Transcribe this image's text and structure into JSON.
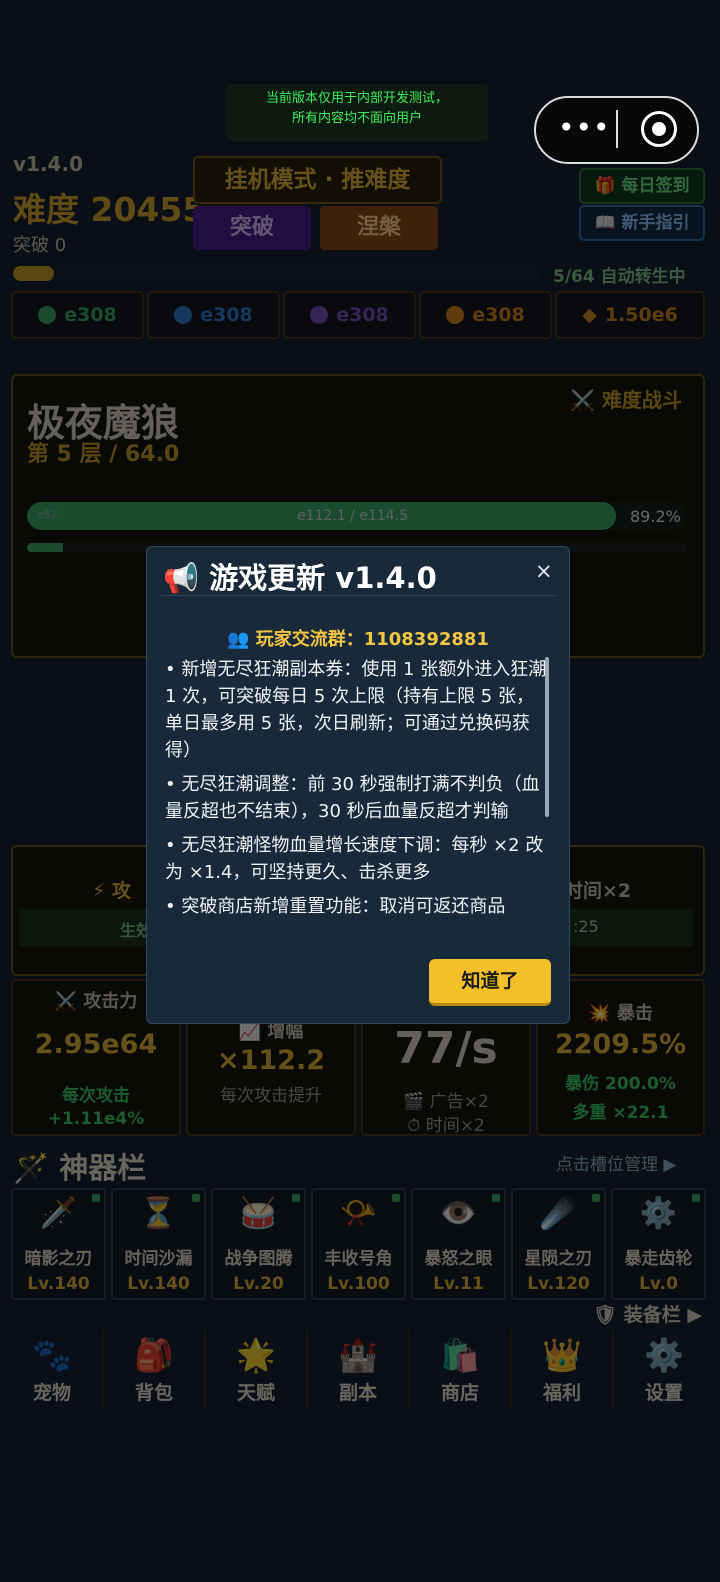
{
  "notice": {
    "line1": "当前版本仅用于内部开发测试，",
    "line2": "所有内容均不面向用户"
  },
  "capsule": {
    "more": "•••"
  },
  "header": {
    "version": "v1.4.0",
    "difficulty": "难度 20455",
    "breakthrough": "突破 0",
    "mode_button": "挂机模式 · 推难度",
    "break_button": "突破",
    "nirvana_button": "涅槃",
    "daily_button": "🎁 每日签到",
    "guide_button": "📖 新手指引",
    "progress_text": "5/64 自动转生中",
    "progress_value": 0.078
  },
  "resources": [
    {
      "value": "e308",
      "color": "#3da866"
    },
    {
      "value": "e308",
      "color": "#2f7fd0"
    },
    {
      "value": "e308",
      "color": "#7a4fc0"
    },
    {
      "value": "e308",
      "color": "#d1861a"
    },
    {
      "value": "1.50e6",
      "color": "#d1861a"
    }
  ],
  "boss": {
    "name": "极夜魔狼",
    "layer": "第 5 层 / 64.0",
    "battle_label": "⚔️ 难度战斗",
    "hp_mini": "e52",
    "hp_text": "e112.1 / e114.5",
    "hp_percent": "89.2%",
    "hp_fill": 0.892,
    "sub_fill": 0.055
  },
  "mid": {
    "left_label": "⚡ 攻",
    "right_label": "时间×2",
    "bar_left": "生效",
    "bar_right": ":25"
  },
  "stats": [
    {
      "title": "⚔️ 攻击力",
      "value": "2.95e64",
      "sub1": "每次攻击",
      "sub2": "+1.11e4%"
    },
    {
      "title": "📈 增幅",
      "value": "×112.2",
      "sub1": "每次攻击提升",
      "sub2": ""
    },
    {
      "title": "",
      "value": "77/s",
      "sub1": "🎬 广告×2",
      "sub2": "⏱ 时间×2"
    },
    {
      "title": "💥 暴击",
      "value": "2209.5%",
      "sub1": "暴伤 200.0%",
      "sub2": "多重 ×22.1"
    }
  ],
  "artifacts": {
    "title": "🪄 神器栏",
    "slot_manage": "点击槽位管理 ▶",
    "equip_bar": "🛡 装备栏 ▶",
    "items": [
      {
        "icon": "🗡️",
        "name": "暗影之刃",
        "level": "Lv.140"
      },
      {
        "icon": "⏳",
        "name": "时间沙漏",
        "level": "Lv.140"
      },
      {
        "icon": "🥁",
        "name": "战争图腾",
        "level": "Lv.20"
      },
      {
        "icon": "📯",
        "name": "丰收号角",
        "level": "Lv.100"
      },
      {
        "icon": "👁️",
        "name": "暴怒之眼",
        "level": "Lv.11"
      },
      {
        "icon": "☄️",
        "name": "星陨之刃",
        "level": "Lv.120"
      },
      {
        "icon": "⚙️",
        "name": "暴走齿轮",
        "level": "Lv.0"
      }
    ]
  },
  "nav": [
    {
      "icon": "🐾",
      "label": "宠物"
    },
    {
      "icon": "🎒",
      "label": "背包"
    },
    {
      "icon": "🌟",
      "label": "天赋"
    },
    {
      "icon": "🏰",
      "label": "副本"
    },
    {
      "icon": "🛍️",
      "label": "商店"
    },
    {
      "icon": "👑",
      "label": "福利"
    },
    {
      "icon": "⚙️",
      "label": "设置"
    }
  ],
  "modal": {
    "title": "📢 游戏更新 v1.4.0",
    "close": "×",
    "group": "👥 玩家交流群：1108392881",
    "notes": [
      "• 新增无尽狂潮副本券：使用 1 张额外进入狂潮 1 次，可突破每日 5 次上限（持有上限 5 张，单日最多用 5 张，次日刷新；可通过兑换码获得）",
      "• 无尽狂潮调整：前 30 秒强制打满不判负（血量反超也不结束），30 秒后血量反超才判输",
      "• 无尽狂潮怪物血量增长速度下调：每秒 ×2 改为 ×1.4，可坚持更久、击杀更多",
      "• 突破商店新增重置功能：取消可返还商品"
    ],
    "ok_button": "知道了"
  }
}
